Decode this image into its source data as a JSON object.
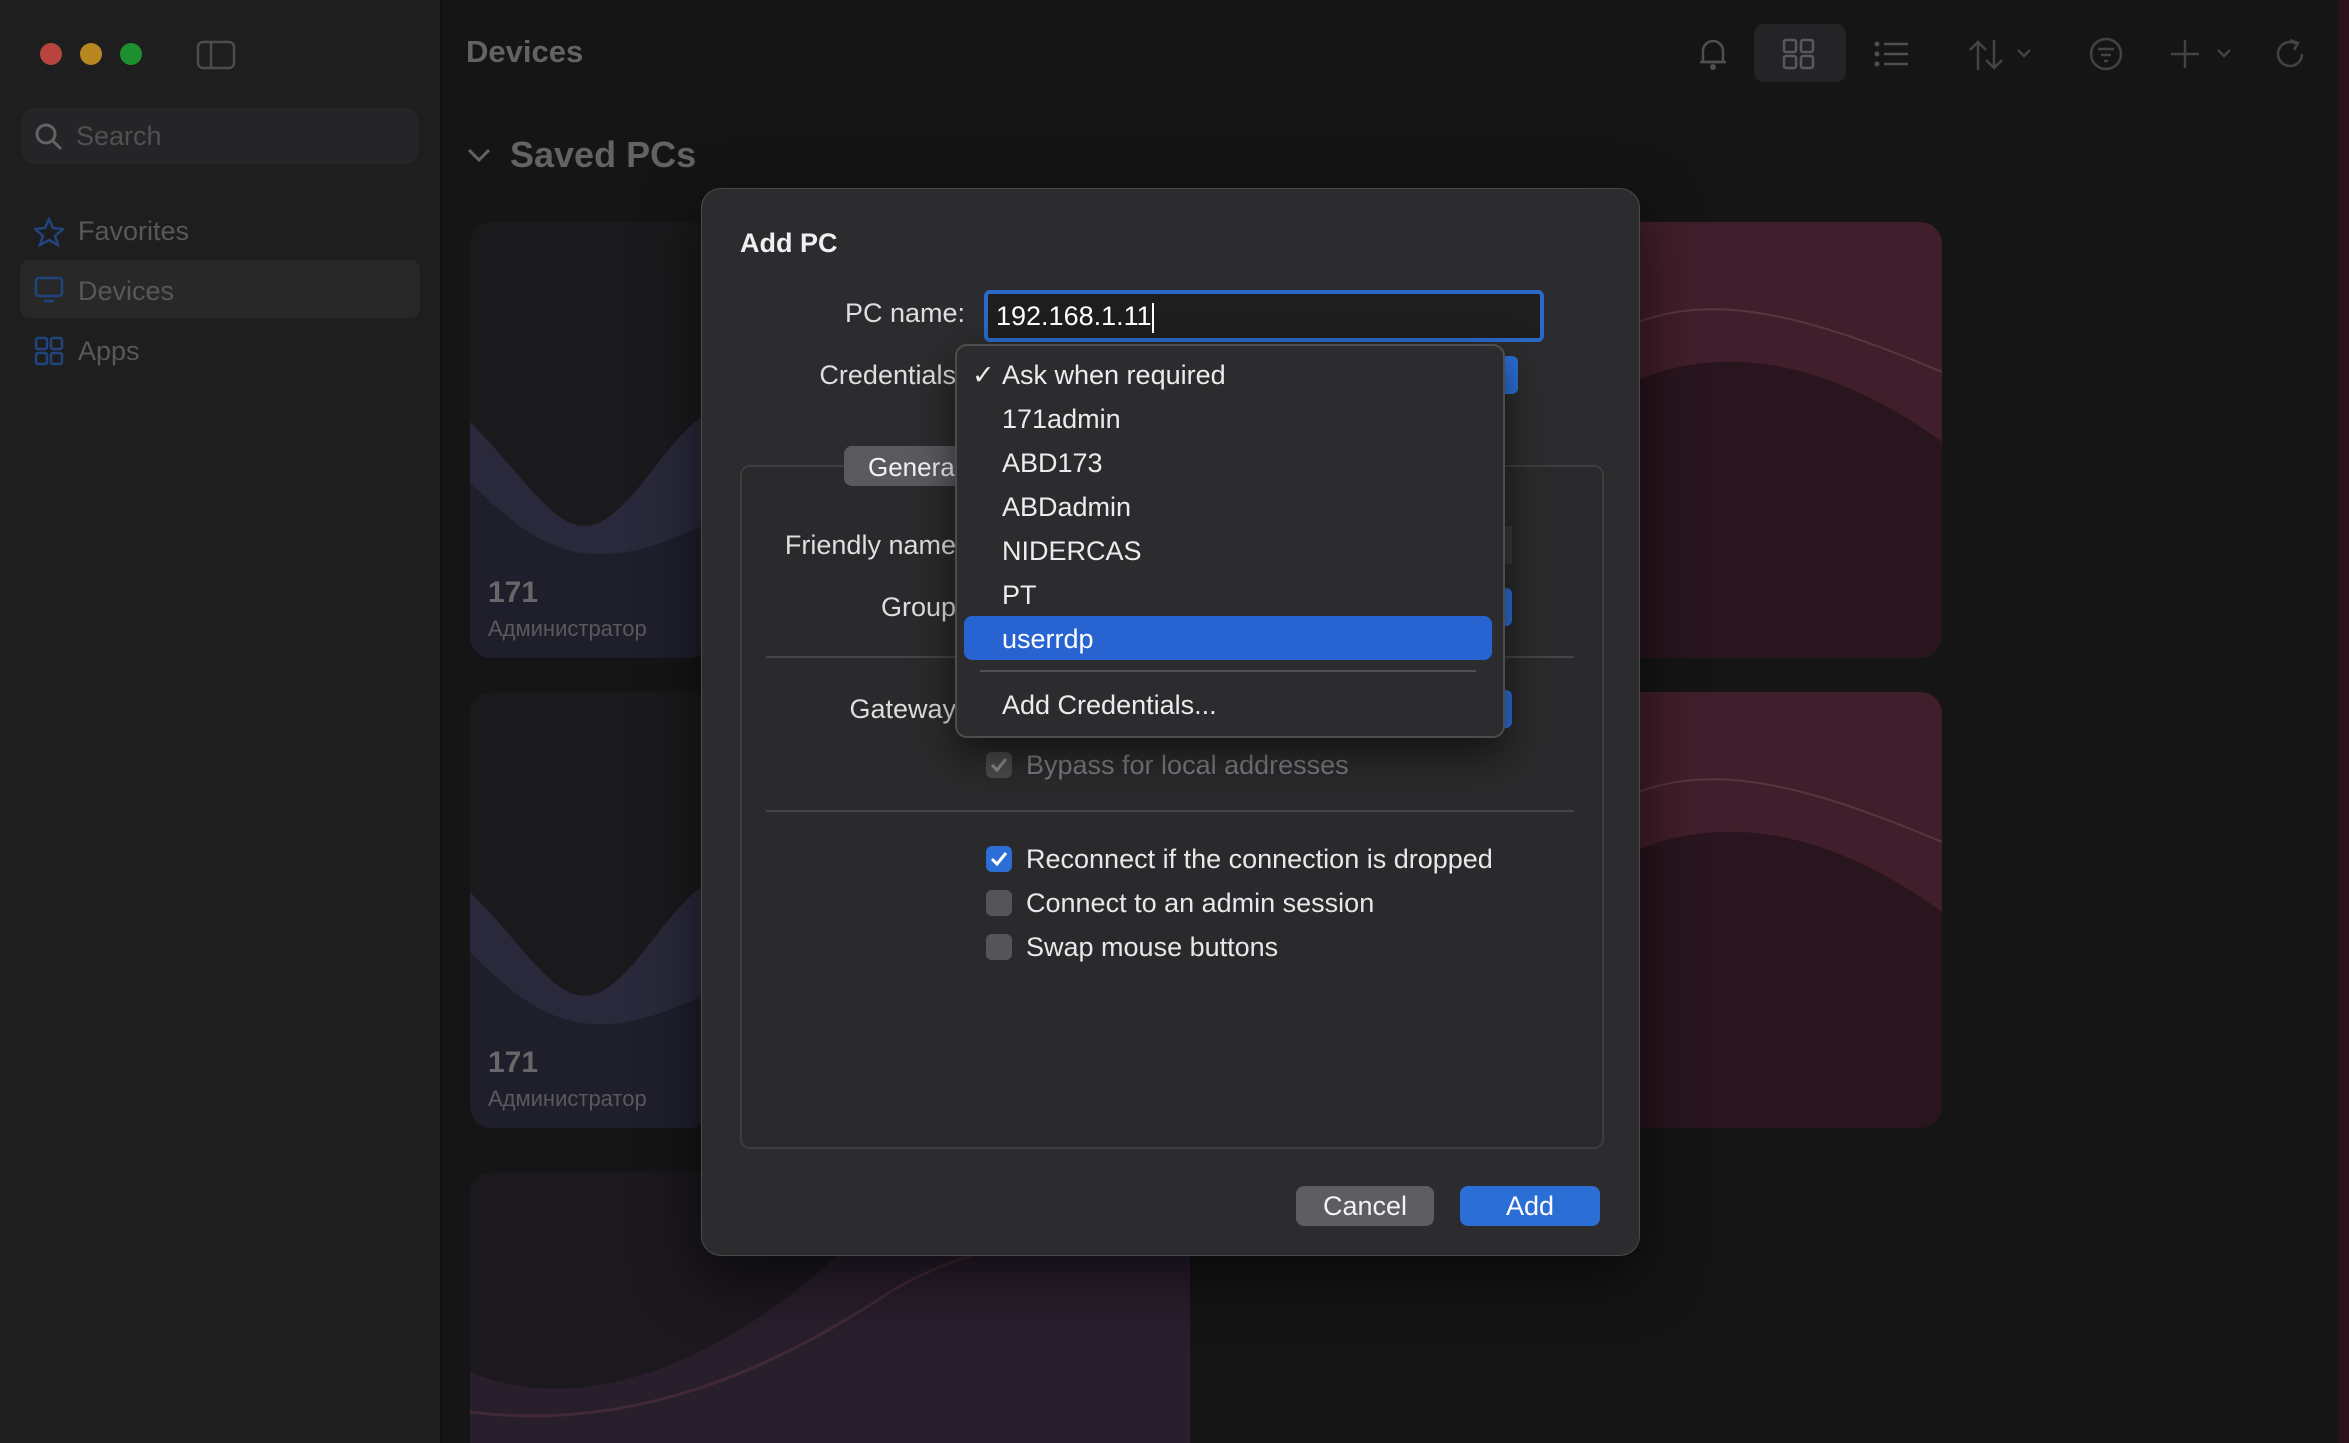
{
  "window": {
    "title": "Devices"
  },
  "sidebar": {
    "search_placeholder": "Search",
    "items": [
      {
        "label": "Favorites",
        "icon": "star-icon"
      },
      {
        "label": "Devices",
        "icon": "monitor-icon",
        "selected": true
      },
      {
        "label": "Apps",
        "icon": "apps-grid-icon"
      }
    ]
  },
  "toolbar": {
    "icons": [
      "bell-icon",
      "grid-view-icon",
      "list-view-icon",
      "sort-icon",
      "filter-icon",
      "add-icon",
      "refresh-icon"
    ]
  },
  "section": {
    "title": "Saved PCs"
  },
  "cards": [
    {
      "name": "171",
      "user": "Администратор"
    },
    {
      "name": "171",
      "user": "Администратор"
    }
  ],
  "dialog": {
    "title": "Add PC",
    "pc_name_label": "PC name:",
    "pc_name_value": "192.168.1.11",
    "credentials_label": "Credentials",
    "tab_general": "Genera",
    "friendly_name_label": "Friendly name",
    "group_label": "Group",
    "gateway_label": "Gateway",
    "bypass_label": "Bypass for local addresses",
    "reconnect_label": "Reconnect if the connection is dropped",
    "admin_label": "Connect to an admin session",
    "swap_label": "Swap mouse buttons",
    "cancel": "Cancel",
    "add": "Add"
  },
  "credentials_menu": {
    "check": "✓",
    "items": [
      "Ask when required",
      "171admin",
      "ABD173",
      "ABDadmin",
      "NIDERCAS",
      "PT",
      "userrdp"
    ],
    "checked_index": 0,
    "highlighted_index": 6,
    "add_item": "Add Credentials..."
  },
  "colors": {
    "accent": "#2b6fd6",
    "close": "#ff5f57",
    "minimize": "#febc2e",
    "zoom": "#28c840"
  }
}
